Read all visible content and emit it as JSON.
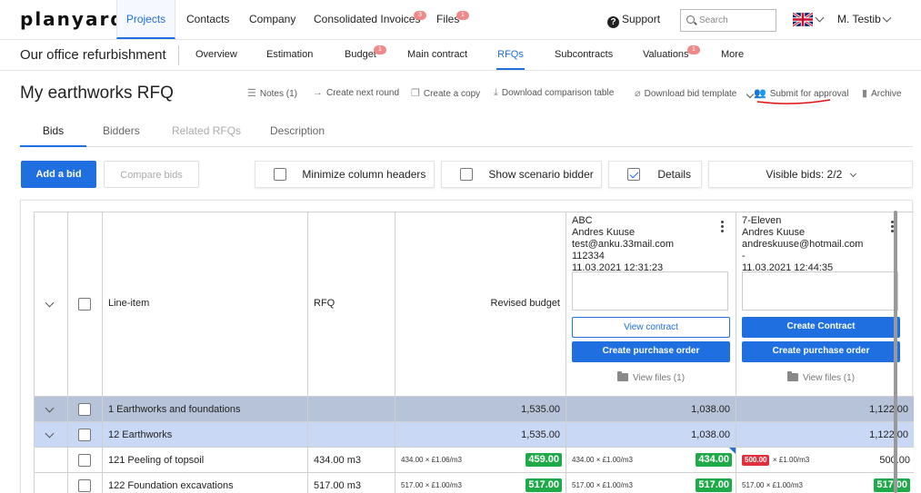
{
  "app": {
    "logo": "planyard"
  },
  "topnav": {
    "items": [
      {
        "label": "Projects",
        "active": true
      },
      {
        "label": "Contacts"
      },
      {
        "label": "Company"
      },
      {
        "label": "Consolidated Invoices",
        "badge": "3"
      },
      {
        "label": "Files",
        "badge": "1"
      }
    ],
    "support": "Support",
    "search_placeholder": "Search",
    "user": "M. Testib"
  },
  "project": {
    "name": "Our office refurbishment",
    "tabs": [
      {
        "label": "Overview"
      },
      {
        "label": "Estimation"
      },
      {
        "label": "Budget",
        "badge": "1"
      },
      {
        "label": "Main contract"
      },
      {
        "label": "RFQs",
        "active": true
      },
      {
        "label": "Subcontracts"
      },
      {
        "label": "Valuations",
        "badge": "1"
      },
      {
        "label": "More"
      }
    ]
  },
  "rfq": {
    "title": "My earthworks RFQ",
    "actions": [
      {
        "label": "Notes (1)",
        "icon": "notes-icon"
      },
      {
        "label": "Create next round",
        "icon": "arrow-right-icon"
      },
      {
        "label": "Create a copy",
        "icon": "copy-icon"
      },
      {
        "label": "Download comparison table",
        "icon": "download-icon"
      },
      {
        "label": "Download bid template",
        "icon": "paperclip-icon"
      },
      {
        "label": "Submit for approval",
        "icon": "users-icon"
      },
      {
        "label": "Archive",
        "icon": "trash-icon"
      }
    ],
    "subtabs": [
      {
        "label": "Bids",
        "active": true
      },
      {
        "label": "Bidders"
      },
      {
        "label": "Related RFQs",
        "disabled": true
      },
      {
        "label": "Description"
      }
    ]
  },
  "toolbar": {
    "add_bid": "Add a bid",
    "compare_bids": "Compare bids",
    "minimize_headers": "Minimize column headers",
    "show_scenario": "Show scenario bidder",
    "details": "Details",
    "details_checked": true,
    "visible_bids": "Visible bids: 2/2"
  },
  "table": {
    "headers": {
      "line_item": "Line-item",
      "rfq": "RFQ",
      "revised_budget": "Revised budget"
    },
    "bidders": [
      {
        "company": "ABC",
        "contact": "Andres Kuuse",
        "email": "test@anku.33mail.com",
        "phone": "112334",
        "date": "11.03.2021 12:31:23",
        "primary_button": "View contract",
        "secondary_button": "Create purchase order",
        "files": "View files (1)"
      },
      {
        "company": "7-Eleven",
        "contact": "Andres Kuuse",
        "email": "andreskuuse@hotmail.com",
        "phone": "-",
        "date": "11.03.2021 12:44:35",
        "primary_button": "Create Contract",
        "secondary_button": "Create purchase order",
        "files": "View files (1)"
      }
    ],
    "rows": [
      {
        "label": "1 Earthworks and foundations",
        "rfq": "",
        "budget_calc": "",
        "budget": "1,535.00",
        "bid1_calc": "",
        "bid1": "1,038.00",
        "bid2_calc": "",
        "bid2": "1,122.00",
        "level": "group1"
      },
      {
        "label": "12 Earthworks",
        "rfq": "",
        "budget_calc": "",
        "budget": "1,535.00",
        "bid1_calc": "",
        "bid1": "1,038.00",
        "bid2_calc": "",
        "bid2": "1,122.00",
        "level": "group2"
      },
      {
        "label": "121 Peeling of topsoil",
        "rfq": "434.00 m3",
        "budget_calc": "434.00 × £1.06/m3",
        "budget": "459.00",
        "bid1_calc": "434.00 × £1.00/m3",
        "bid1": "434.00",
        "bid2_red": "500.00",
        "bid2_calc": "× £1.00/m3",
        "bid2": "500.00",
        "level": "item"
      },
      {
        "label": "122 Foundation excavations",
        "rfq": "517.00 m3",
        "budget_calc": "517.00 × £1.00/m3",
        "budget": "517.00",
        "bid1_calc": "517.00 × £1.00/m3",
        "bid1": "517.00",
        "bid2_calc": "517.00 × £1.00/m3",
        "bid2": "517.00",
        "level": "item"
      }
    ]
  },
  "colors": {
    "accent": "#1f6fe0",
    "green": "#1faa4a",
    "red": "#e0303c",
    "group1": "#b7c3d9",
    "group2": "#c9d8f5"
  }
}
